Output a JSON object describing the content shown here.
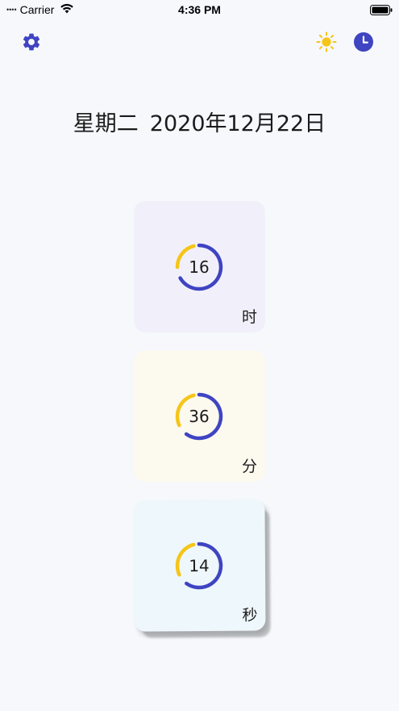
{
  "status_bar": {
    "signal": "••••",
    "carrier": "Carrier",
    "time": "4:36 PM",
    "wifi_icon": "wifi-icon",
    "battery_icon": "battery-full-icon"
  },
  "toolbar": {
    "settings_icon": "gear-icon",
    "brightness_icon": "sun-icon",
    "clock_icon": "clock-icon"
  },
  "date": {
    "weekday": "星期二",
    "full_date": "2020年12月22日"
  },
  "colors": {
    "accent_blue": "#3f44c2",
    "accent_yellow": "#f5c518",
    "background": "#f7f8fc",
    "hour_card_bg": "#f1f0fa",
    "minute_card_bg": "#fcf9ef",
    "second_card_bg": "#eef7fb"
  },
  "cards": {
    "hour": {
      "value": "16",
      "unit": "时",
      "fraction": 0.6667
    },
    "minute": {
      "value": "36",
      "unit": "分",
      "fraction": 0.6
    },
    "second": {
      "value": "14",
      "unit": "秒",
      "fraction": 0.6
    }
  }
}
